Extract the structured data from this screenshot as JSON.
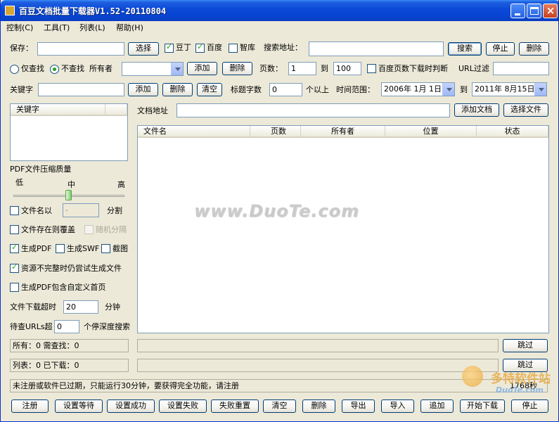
{
  "window": {
    "title": "百豆文档批量下载器V1.52-20110804",
    "title_color": "#0a48d6"
  },
  "menu": [
    "控制(C)",
    "工具(T)",
    "列表(L)",
    "帮助(H)"
  ],
  "row1": {
    "save_label": "保存：",
    "save_value": "",
    "choose_button": "选择",
    "doudin_label": "豆丁",
    "baidu_label": "百度",
    "zhiku_label": "智库",
    "search_addr_label": "搜索地址：",
    "search_addr_value": "",
    "search_button": "搜索",
    "stop_button": "停止",
    "delete_button": "删除"
  },
  "row2": {
    "only_find_label": "仅查找",
    "no_find_label": "不查找",
    "owner_label": "所有者",
    "owner_value": "",
    "add_button": "添加",
    "delete_button": "删除",
    "pages_label": "页数：",
    "pages_from": "1",
    "to_label": "到",
    "pages_to": "100",
    "baidu_pages_label": "百度页数下载时判断",
    "url_filter_label": "URL过滤",
    "url_filter_value": ""
  },
  "row3": {
    "keyword_label": "关键字",
    "keyword_value": "",
    "add_button": "添加",
    "delete_button": "删除",
    "clear_button": "清空",
    "title_chars_label": "标题字数",
    "title_chars_value": "0",
    "above_label": "个以上",
    "time_range_label": "时间范围：",
    "date_from": "2006年 1月 1日",
    "to_label": "到",
    "date_to": "2011年 8月15日"
  },
  "keyword_list": {
    "header": "关键字"
  },
  "options": {
    "pdf_quality_label": "PDF文件压缩质量",
    "low": "低",
    "mid": "中",
    "high": "高",
    "pdf_quality_level": 0.5,
    "filename_label": "文件名以",
    "filename_sep_value": "-",
    "split_label": "分割",
    "overwrite_label": "文件存在则覆盖",
    "random_sep_label": "随机分隔",
    "gen_pdf_label": "生成PDF",
    "gen_swf_label": "生成SWF",
    "screenshot_label": "截图",
    "incomplete_label": "资源不完整时仍尝试生成文件",
    "custom_cover_label": "生成PDF包含自定义首页",
    "timeout_label": "文件下载超时",
    "timeout_value": "20",
    "minutes_label": "分钟",
    "pending_label": "待查URLs超",
    "pending_value": "0",
    "stop_depth_label": "个停深度搜索"
  },
  "doc": {
    "address_label": "文档地址",
    "address_value": "",
    "add_doc_button": "添加文档",
    "choose_file_button": "选择文件",
    "columns": [
      "文件名",
      "页数",
      "所有者",
      "位置",
      "状态"
    ]
  },
  "status": {
    "all_text": "所有：0 需查找：0",
    "list_text": "列表：0 已下载：0",
    "skip1_button": "跳过",
    "skip2_button": "跳过",
    "notice": "未注册或软件已过期，只能运行30分钟，要获得完全功能，请注册",
    "seconds": "1768秒"
  },
  "bottom_buttons": [
    "注册",
    "设置等待",
    "设置成功",
    "设置失败",
    "失败重置",
    "清空",
    "删除",
    "导出",
    "导入",
    "追加",
    "开始下载",
    "停止"
  ],
  "watermark": {
    "center": "www.DuoTe.com",
    "corner_cn": "多特软件站",
    "corner_en": "DuoTe.com"
  },
  "colors": {
    "accent": "#0a48d6",
    "check_green": "#21a121",
    "watermark_orange": "#e8a63c"
  }
}
